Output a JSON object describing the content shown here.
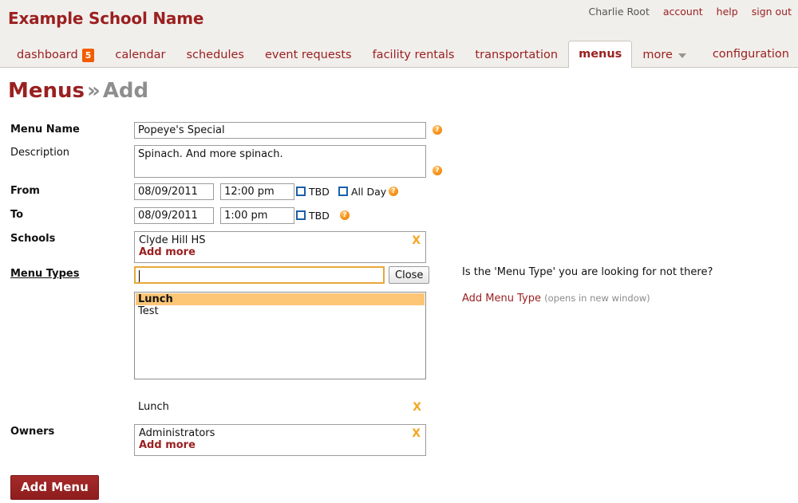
{
  "header": {
    "brand": "Example School Name",
    "user_name": "Charlie Root",
    "links": [
      {
        "label": "account",
        "name": "account-link"
      },
      {
        "label": "help",
        "name": "help-link"
      },
      {
        "label": "sign out",
        "name": "sign-out-link"
      }
    ]
  },
  "nav": {
    "tabs": [
      {
        "label": "dashboard",
        "badge": "5",
        "active": false
      },
      {
        "label": "calendar",
        "badge": null,
        "active": false
      },
      {
        "label": "schedules",
        "badge": null,
        "active": false
      },
      {
        "label": "event requests",
        "badge": null,
        "active": false
      },
      {
        "label": "facility rentals",
        "badge": null,
        "active": false
      },
      {
        "label": "transportation",
        "badge": null,
        "active": false
      },
      {
        "label": "menus",
        "badge": null,
        "active": true
      },
      {
        "label": "more",
        "badge": null,
        "active": false,
        "caret": true
      }
    ],
    "configuration_label": "configuration"
  },
  "page": {
    "title_main": "Menus",
    "title_separator": "»",
    "title_sub": "Add"
  },
  "form": {
    "menu_name": {
      "label": "Menu Name",
      "value": "Popeye's Special",
      "help": "?"
    },
    "description": {
      "label": "Description",
      "value": "Spinach. And more spinach.",
      "help": "?"
    },
    "from": {
      "label": "From",
      "date": "08/09/2011",
      "time": "12:00 pm",
      "tbd_label": "TBD",
      "tbd_checked": false,
      "allday_label": "All Day",
      "allday_checked": false,
      "help": "?"
    },
    "to": {
      "label": "To",
      "date": "08/09/2011",
      "time": "1:00 pm",
      "tbd_label": "TBD",
      "tbd_checked": false,
      "help": "?"
    },
    "schools": {
      "label": "Schools",
      "items": [
        "Clyde Hill HS"
      ],
      "add_more_label": "Add more",
      "remove_label": "X"
    },
    "menu_types": {
      "label": "Menu Types",
      "search_value": "",
      "close_label": "Close",
      "options": [
        {
          "label": "Lunch",
          "selected": true
        },
        {
          "label": "Test",
          "selected": false
        }
      ],
      "chosen": [
        {
          "label": "Lunch",
          "remove_label": "X"
        }
      ]
    },
    "owners": {
      "label": "Owners",
      "items": [
        "Administrators"
      ],
      "add_more_label": "Add more",
      "remove_label": "X"
    },
    "submit_label": "Add Menu"
  },
  "side_help": {
    "question": "Is the 'Menu Type' you are looking for not there?",
    "link_label": "Add Menu Type",
    "note": "(opens in new window)"
  },
  "colors": {
    "brand_red": "#9b2020",
    "badge_orange": "#f25c00",
    "accent_gold": "#e8a83a",
    "remove_orange": "#f5a623",
    "highlight": "#fdc677"
  }
}
